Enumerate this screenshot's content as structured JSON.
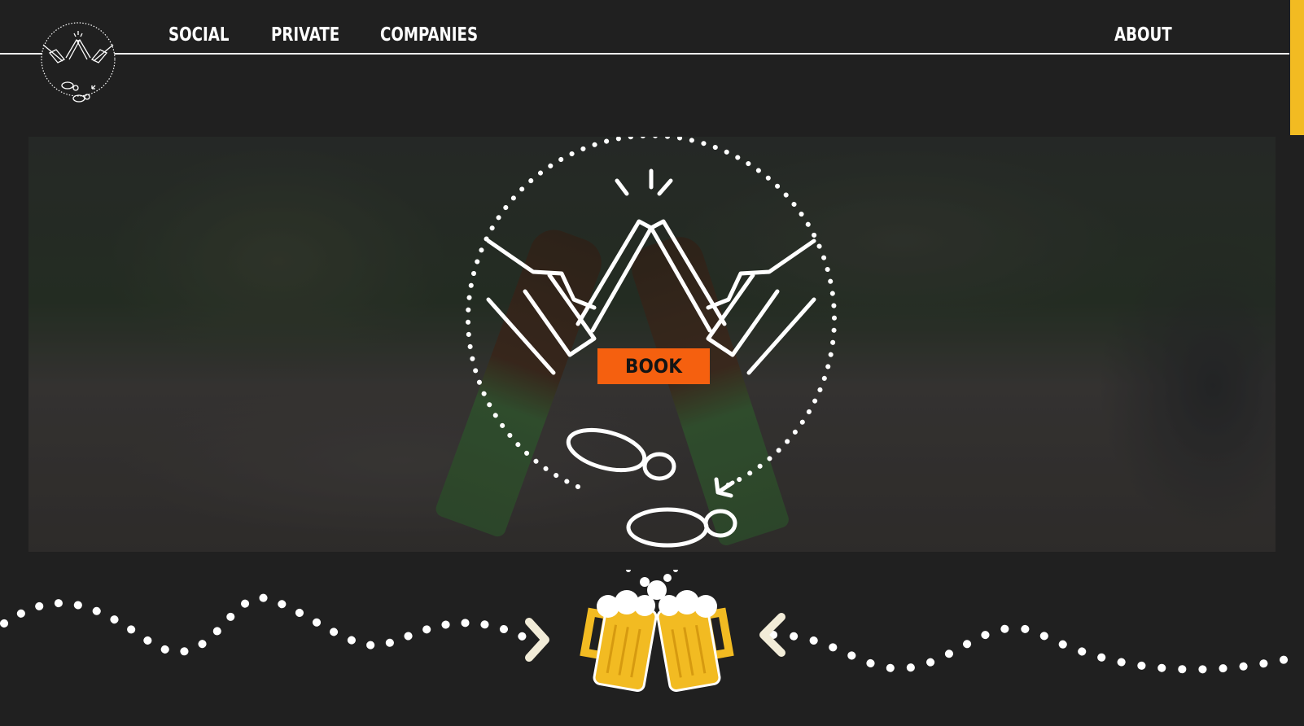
{
  "nav": {
    "items": [
      {
        "label": "SOCIAL"
      },
      {
        "label": "PRIVATE"
      },
      {
        "label": "COMPANIES"
      }
    ],
    "about": "ABOUT"
  },
  "hero": {
    "book_label": "BOOK"
  },
  "colors": {
    "background": "#202020",
    "accent": "#f5600f",
    "scroll_thumb": "#f2bb22",
    "beer": "#f2bb22"
  }
}
